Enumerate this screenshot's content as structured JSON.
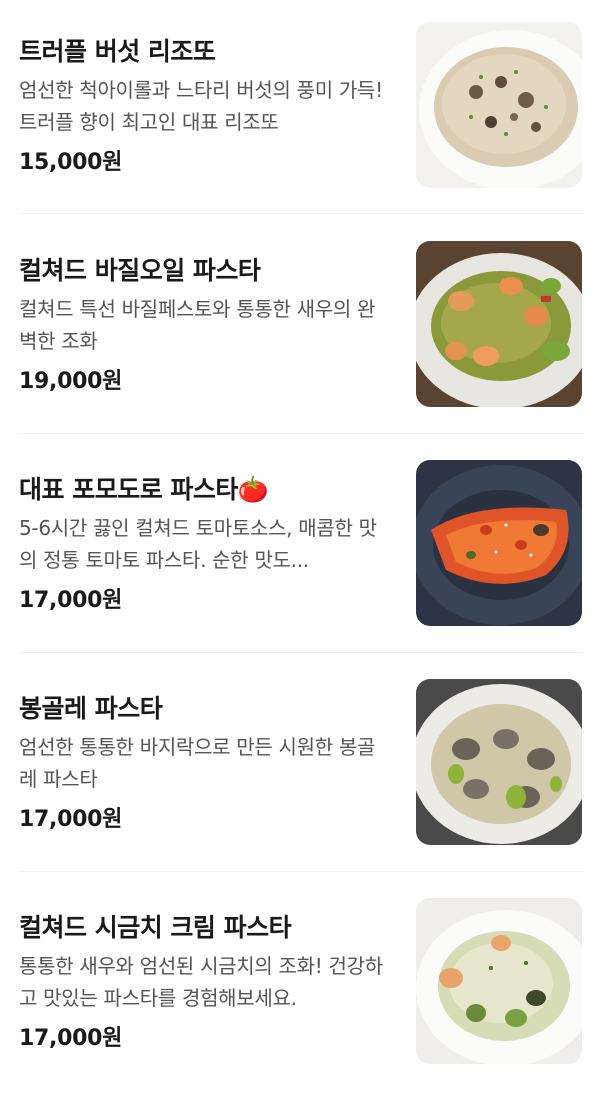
{
  "currency_suffix": "원",
  "menu": [
    {
      "name": "트러플 버섯 리조또",
      "description": "엄선한 척아이롤과 느타리 버섯의 풍미 가득! 트러플 향이 최고인 대표 리조또",
      "price": "15,000원",
      "image_icon": "risotto-photo"
    },
    {
      "name": "컬쳐드 바질오일 파스타",
      "description": "컬쳐드 특선 바질페스토와 통통한 새우의 완벽한 조화",
      "price": "19,000원",
      "image_icon": "basil-pasta-photo"
    },
    {
      "name": "대표 포모도로 파스타🍅",
      "description": "5-6시간 끓인 컬쳐드 토마토소스, 매콤한 맛의 정통 토마토 파스타. 순한 맛도...",
      "price": "17,000원",
      "image_icon": "pomodoro-pasta-photo"
    },
    {
      "name": "봉골레 파스타",
      "description": "엄선한 통통한 바지락으로 만든 시원한 봉골레 파스타",
      "price": "17,000원",
      "image_icon": "vongole-pasta-photo"
    },
    {
      "name": "컬쳐드 시금치 크림 파스타",
      "description": "통통한 새우와 엄선된 시금치의 조화! 건강하고 맛있는 파스타를 경험해보세요.",
      "price": "17,000원",
      "image_icon": "spinach-cream-pasta-photo"
    }
  ]
}
